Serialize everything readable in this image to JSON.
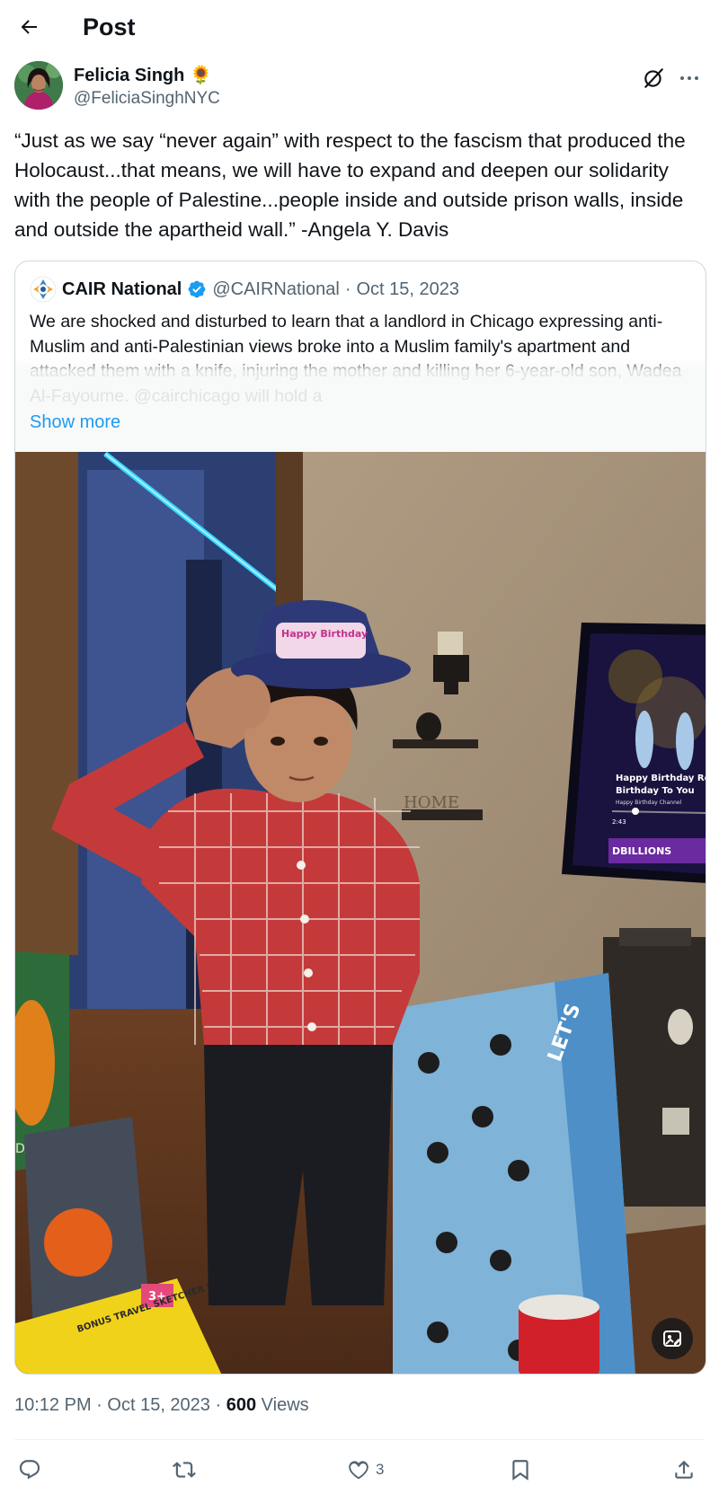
{
  "header": {
    "back_icon": "arrow-left-icon",
    "title": "Post"
  },
  "author": {
    "name": "Felicia Singh",
    "emoji": "🌻",
    "handle": "@FeliciaSinghNYC"
  },
  "post": {
    "text": "“Just as we say “never again” with respect to the fascism that produced the Holocaust...that means, we will have to expand and deepen our solidarity with the people of Palestine...people inside and outside prison walls, inside and outside the apartheid wall.” -Angela Y. Davis"
  },
  "quote": {
    "name": "CAIR National",
    "handle": "@CAIRNational",
    "separator": "·",
    "date": "Oct 15, 2023",
    "text": "We are shocked and disturbed to learn that a landlord in Chicago expressing anti-Muslim and anti-Palestinian views broke into a Muslim family's apartment and attacked them with a knife, injuring the mother and killing her 6-year-old son, Wadea Al-Fayoume. @cairchicago will hold a",
    "show_more": "Show more",
    "verified_color": "#1d9bf0",
    "photo": {
      "hat_text": "Happy Birthday",
      "tv_line1": "Happy Birthday Remix",
      "tv_line2": "Birthday To You",
      "tv_line3": "Happy Birthday Channel",
      "tv_time": "2:43",
      "tv_brand": "DBILLIONS",
      "shelf_sign": "HOME",
      "box_text": "BONUS TRAVEL SKETCHER INCLUDED!",
      "box_age": "3+",
      "bag_text": "LET'S"
    }
  },
  "meta": {
    "time": "10:12 PM",
    "dot": "·",
    "date": "Oct 15, 2023",
    "views_count": "600",
    "views_label": "Views"
  },
  "actions": {
    "likes": "3"
  },
  "colors": {
    "accent": "#1d9bf0",
    "text_secondary": "#536471",
    "border": "#cfd9de"
  }
}
